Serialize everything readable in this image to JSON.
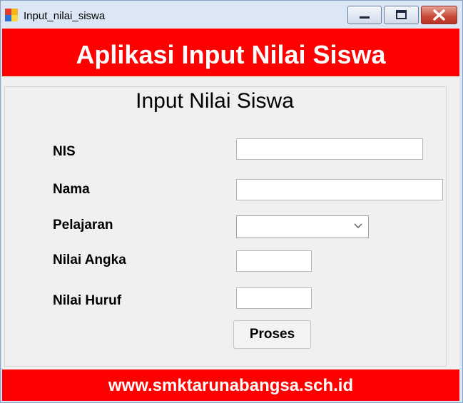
{
  "window": {
    "title": "Input_nilai_siswa",
    "controls": {
      "minimize_icon": "minimize-icon",
      "maximize_icon": "maximize-icon",
      "close_icon": "close-icon"
    }
  },
  "header": {
    "title": "Aplikasi Input Nilai Siswa",
    "background": "#ff0000",
    "color": "#ffffff"
  },
  "form": {
    "title": "Input Nilai Siswa",
    "fields": {
      "nis": {
        "label": "NIS",
        "value": ""
      },
      "nama": {
        "label": "Nama",
        "value": ""
      },
      "pelajaran": {
        "label": "Pelajaran",
        "value": ""
      },
      "nilai_angka": {
        "label": "Nilai Angka",
        "value": ""
      },
      "nilai_huruf": {
        "label": "Nilai Huruf",
        "value": ""
      }
    },
    "submit_label": "Proses"
  },
  "footer": {
    "text": "www.smktarunabangsa.sch.id",
    "background": "#ff0000"
  }
}
